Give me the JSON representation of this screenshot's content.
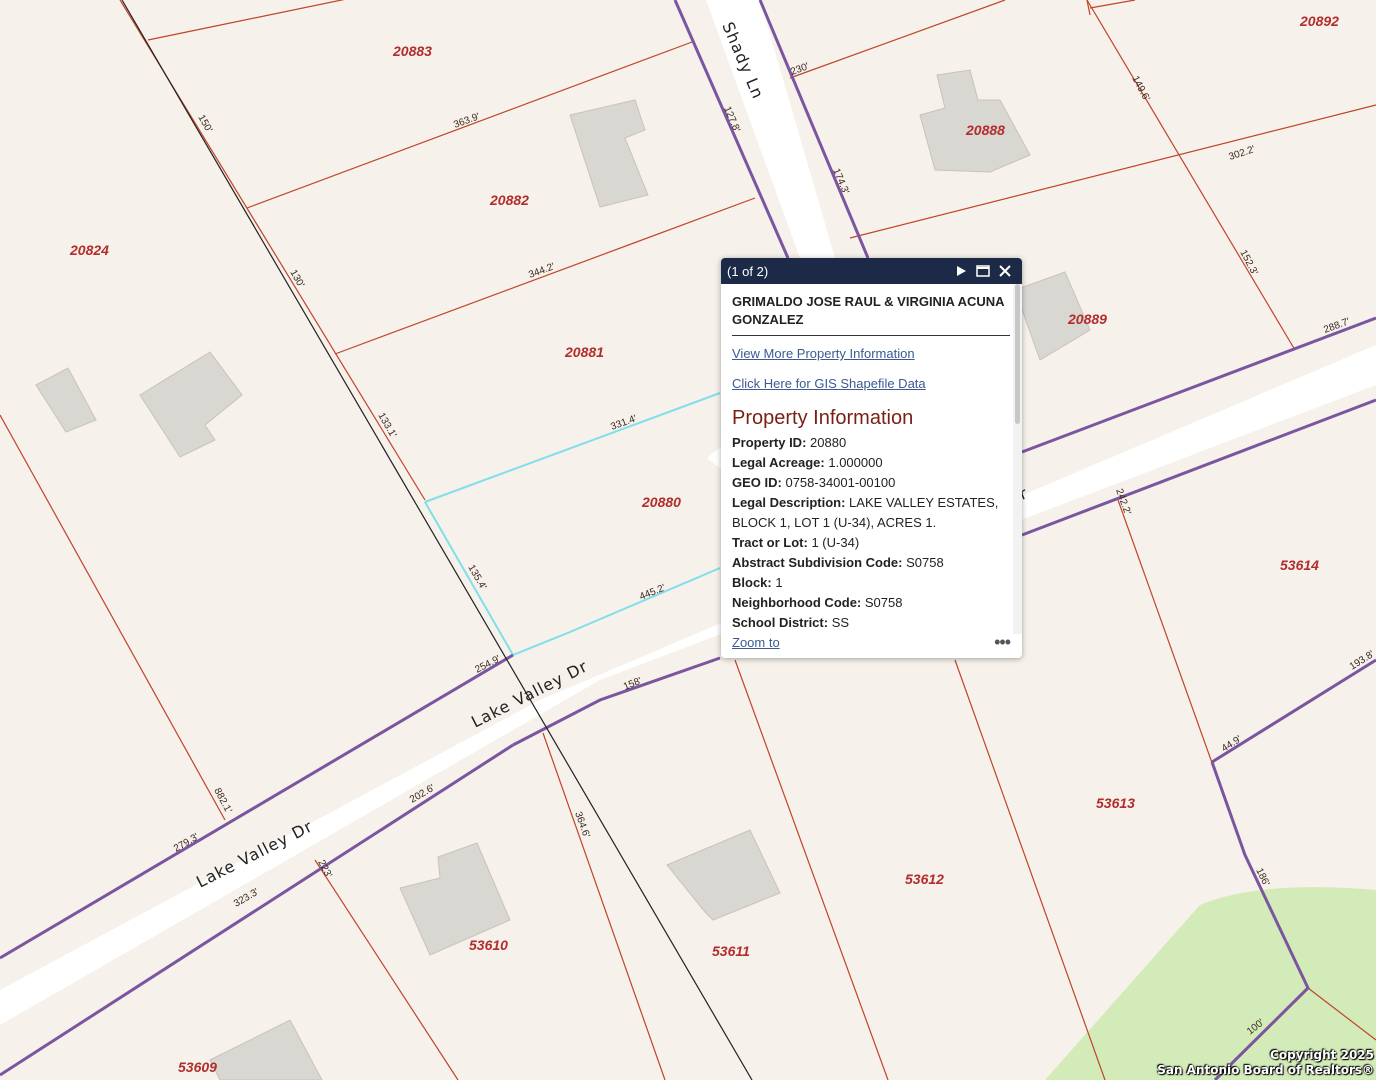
{
  "map": {
    "parcels": [
      "20883",
      "20892",
      "20888",
      "20882",
      "20824",
      "20889",
      "20881",
      "20880",
      "53614",
      "53613",
      "53612",
      "53611",
      "53610",
      "53609"
    ],
    "dimensions": [
      "150'",
      "363.9'",
      "127.8'",
      "230'",
      "149.6'",
      "174.3'",
      "302.2'",
      "130'",
      "344.2'",
      "152.3'",
      "288.7'",
      "133.1'",
      "331.4'",
      "135.4'",
      "445.2'",
      "254.9'",
      "158'",
      "202.6'",
      "279.3'",
      "882.1'",
      "223'",
      "323.3'",
      "364.6'",
      "242.2'",
      "193.8'",
      "44.9'",
      "186'",
      "100'"
    ],
    "roads": {
      "shady": "Shady Ln",
      "lake_upper": "Lake Valley Dr",
      "lake_lower": "Lake Valley Dr",
      "lake_fragment": "r"
    },
    "colors": {
      "background": "#f6f1ea",
      "parcel_line": "#c0442a",
      "road_boundary": "#7a55a0",
      "selected_parcel": "#7fdfea",
      "building": "#d9d7d2",
      "green_area": "#d2ebb8",
      "parcel_label": "#b22d2d"
    },
    "copyright_line1": "Copyright 2025",
    "copyright_line2": "San Antonio Board of Realtors®"
  },
  "popup": {
    "count": "(1 of 2)",
    "owner": "GRIMALDO JOSE RAUL & VIRGINIA ACUNA GONZALEZ",
    "link_more": "View More Property Information",
    "link_gis": "Click Here for GIS Shapefile Data",
    "section_title": "Property Information",
    "fields": [
      {
        "label": "Property ID:",
        "value": "20880"
      },
      {
        "label": "Legal Acreage:",
        "value": "1.000000"
      },
      {
        "label": "GEO ID:",
        "value": "0758-34001-00100"
      },
      {
        "label": "Legal Description:",
        "value": "LAKE VALLEY ESTATES, BLOCK 1, LOT 1 (U-34), ACRES 1."
      },
      {
        "label": "Tract or Lot:",
        "value": "1 (U-34)"
      },
      {
        "label": "Abstract Subdivision Code:",
        "value": "S0758"
      },
      {
        "label": "Block:",
        "value": "1"
      },
      {
        "label": "Neighborhood Code:",
        "value": "S0758"
      },
      {
        "label": "School District:",
        "value": "SS"
      }
    ],
    "zoom_to": "Zoom to",
    "more": "•••",
    "icons": [
      "play-icon",
      "maximize-icon",
      "close-icon",
      "more-icon"
    ]
  }
}
